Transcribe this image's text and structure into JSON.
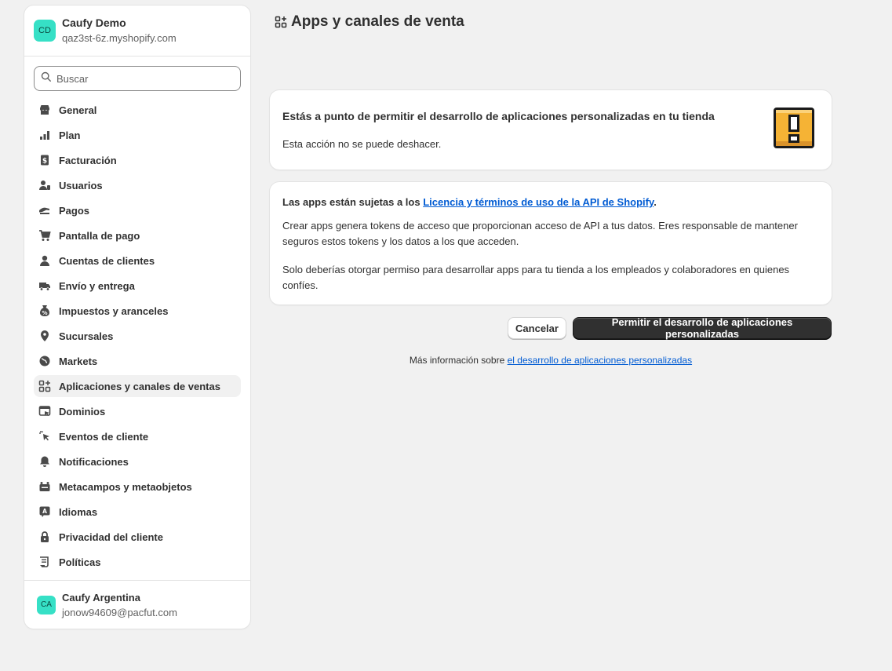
{
  "store": {
    "initials": "CD",
    "name": "Caufy Demo",
    "domain": "qaz3st-6z.myshopify.com"
  },
  "search": {
    "placeholder": "Buscar"
  },
  "nav": {
    "items": [
      {
        "label": "General",
        "icon": "store-icon"
      },
      {
        "label": "Plan",
        "icon": "plan-icon"
      },
      {
        "label": "Facturación",
        "icon": "billing-icon"
      },
      {
        "label": "Usuarios",
        "icon": "users-icon"
      },
      {
        "label": "Pagos",
        "icon": "payments-icon"
      },
      {
        "label": "Pantalla de pago",
        "icon": "cart-icon"
      },
      {
        "label": "Cuentas de clientes",
        "icon": "person-icon"
      },
      {
        "label": "Envío y entrega",
        "icon": "truck-icon"
      },
      {
        "label": "Impuestos y aranceles",
        "icon": "tax-icon"
      },
      {
        "label": "Sucursales",
        "icon": "location-icon"
      },
      {
        "label": "Markets",
        "icon": "globe-icon"
      },
      {
        "label": "Aplicaciones y canales de ventas",
        "icon": "apps-icon",
        "active": true
      },
      {
        "label": "Dominios",
        "icon": "domain-icon"
      },
      {
        "label": "Eventos de cliente",
        "icon": "cursor-icon"
      },
      {
        "label": "Notificaciones",
        "icon": "bell-icon"
      },
      {
        "label": "Metacampos y metaobjetos",
        "icon": "metafield-icon"
      },
      {
        "label": "Idiomas",
        "icon": "language-icon"
      },
      {
        "label": "Privacidad del cliente",
        "icon": "lock-icon"
      },
      {
        "label": "Políticas",
        "icon": "policy-icon"
      }
    ]
  },
  "user": {
    "initials": "CA",
    "name": "Caufy Argentina",
    "email": "jonow94609@pacfut.com"
  },
  "page": {
    "title": "Apps y canales de venta"
  },
  "warning_card": {
    "heading": "Estás a punto de permitir el desarrollo de aplicaciones personalizadas en tu tienda",
    "sub": "Esta acción no se puede deshacer.",
    "icon": "exclamation-block-icon"
  },
  "info_card": {
    "p1_prefix": "Las apps están sujetas a los ",
    "p1_link": "Licencia y términos de uso de la API de Shopify",
    "p1_suffix": ".",
    "p2": "Crear apps genera tokens de acceso que proporcionan acceso de API a tus datos. Eres responsable de mantener seguros estos tokens y los datos a los que acceden.",
    "p3": "Solo deberías otorgar permiso para desarrollar apps para tu tienda a los empleados y colaboradores en quienes confíes."
  },
  "actions": {
    "cancel": "Cancelar",
    "confirm": "Permitir el desarrollo de aplicaciones personalizadas"
  },
  "more_info": {
    "prefix": "Más información sobre ",
    "link": "el desarrollo de aplicaciones personalizadas"
  },
  "colors": {
    "accent": "#36e0c6",
    "link": "#005bd3",
    "primary_button": "#303030",
    "warning": "#f5b335"
  }
}
